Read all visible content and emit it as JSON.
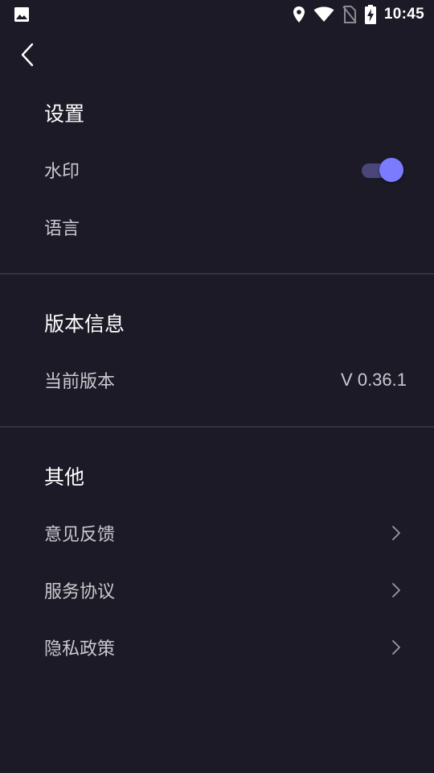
{
  "status_bar": {
    "time": "10:45",
    "icons": [
      "image-icon",
      "location-icon",
      "wifi-icon",
      "no-sim-icon",
      "battery-charging-icon"
    ]
  },
  "nav": {
    "back_icon": "chevron-left-icon"
  },
  "settings": {
    "title": "设置",
    "watermark_label": "水印",
    "watermark_enabled": true,
    "language_label": "语言"
  },
  "version_info": {
    "title": "版本信息",
    "current_version_label": "当前版本",
    "current_version_value": "V 0.36.1"
  },
  "other": {
    "title": "其他",
    "items": [
      {
        "label": "意见反馈",
        "icon": "chevron-right-icon"
      },
      {
        "label": "服务协议",
        "icon": "chevron-right-icon"
      },
      {
        "label": "隐私政策",
        "icon": "chevron-right-icon"
      }
    ]
  },
  "colors": {
    "background": "#1b1a26",
    "accent": "#7b7bff",
    "toggle_track": "#4a4679",
    "divider": "#34333e",
    "secondary_text": "#c9c9cf"
  }
}
